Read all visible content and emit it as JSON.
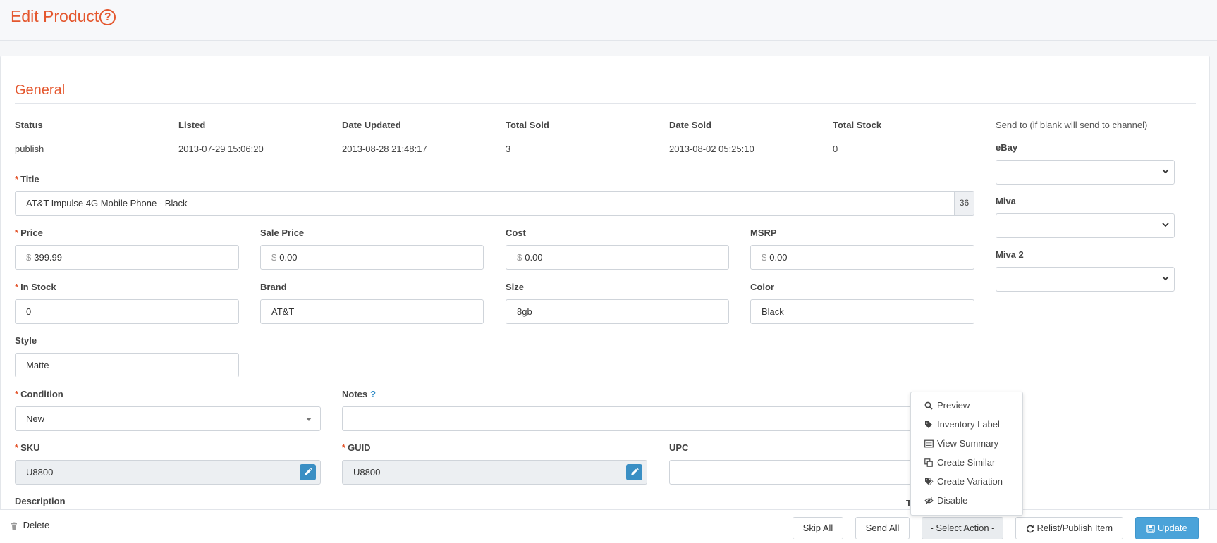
{
  "page": {
    "title": "Edit Product"
  },
  "section": {
    "title": "General"
  },
  "info": {
    "status_label": "Status",
    "status_value": "publish",
    "listed_label": "Listed",
    "listed_value": "2013-07-29 15:06:20",
    "updated_label": "Date Updated",
    "updated_value": "2013-08-28 21:48:17",
    "sold_label": "Total Sold",
    "sold_value": "3",
    "datesold_label": "Date Sold",
    "datesold_value": "2013-08-02 05:25:10",
    "stock_label": "Total Stock",
    "stock_value": "0"
  },
  "sendto": {
    "heading": "Send to (if blank will send to channel)",
    "ebay_label": "eBay",
    "miva_label": "Miva",
    "miva2_label": "Miva 2"
  },
  "title_field": {
    "label": "Title",
    "value": "AT&T Impulse 4G Mobile Phone - Black",
    "count": "36"
  },
  "price": {
    "label": "Price",
    "value": "399.99",
    "currency": "$"
  },
  "sale_price": {
    "label": "Sale Price",
    "value": "0.00",
    "currency": "$"
  },
  "cost": {
    "label": "Cost",
    "value": "0.00",
    "currency": "$"
  },
  "msrp": {
    "label": "MSRP",
    "value": "0.00",
    "currency": "$"
  },
  "in_stock": {
    "label": "In Stock",
    "value": "0"
  },
  "brand": {
    "label": "Brand",
    "value": "AT&T"
  },
  "size": {
    "label": "Size",
    "value": "8gb"
  },
  "color": {
    "label": "Color",
    "value": "Black"
  },
  "style": {
    "label": "Style",
    "value": "Matte"
  },
  "condition": {
    "label": "Condition",
    "value": "New"
  },
  "notes": {
    "label": "Notes",
    "help": "?"
  },
  "sku": {
    "label": "SKU",
    "value": "U8800"
  },
  "guid": {
    "label": "GUID",
    "value": "U8800"
  },
  "upc": {
    "label": "UPC",
    "value": ""
  },
  "description": {
    "label": "Description",
    "clipped_label": "T"
  },
  "required_mark": "*",
  "action_menu": {
    "items": [
      {
        "label": "Preview",
        "icon": "search-icon"
      },
      {
        "label": "Inventory Label",
        "icon": "tag-icon"
      },
      {
        "label": "View Summary",
        "icon": "list-icon"
      },
      {
        "label": "Create Similar",
        "icon": "copy-icon"
      },
      {
        "label": "Create Variation",
        "icon": "tags-icon"
      },
      {
        "label": "Disable",
        "icon": "eye-slash-icon"
      }
    ]
  },
  "footer": {
    "delete": "Delete",
    "skip_all": "Skip All",
    "send_all": "Send All",
    "select_action": "- Select Action -",
    "relist": "Relist/Publish Item",
    "update": "Update"
  },
  "colors": {
    "accent": "#e4572e",
    "primary": "#4ba3d9",
    "edit_button": "#3a8fc4"
  }
}
